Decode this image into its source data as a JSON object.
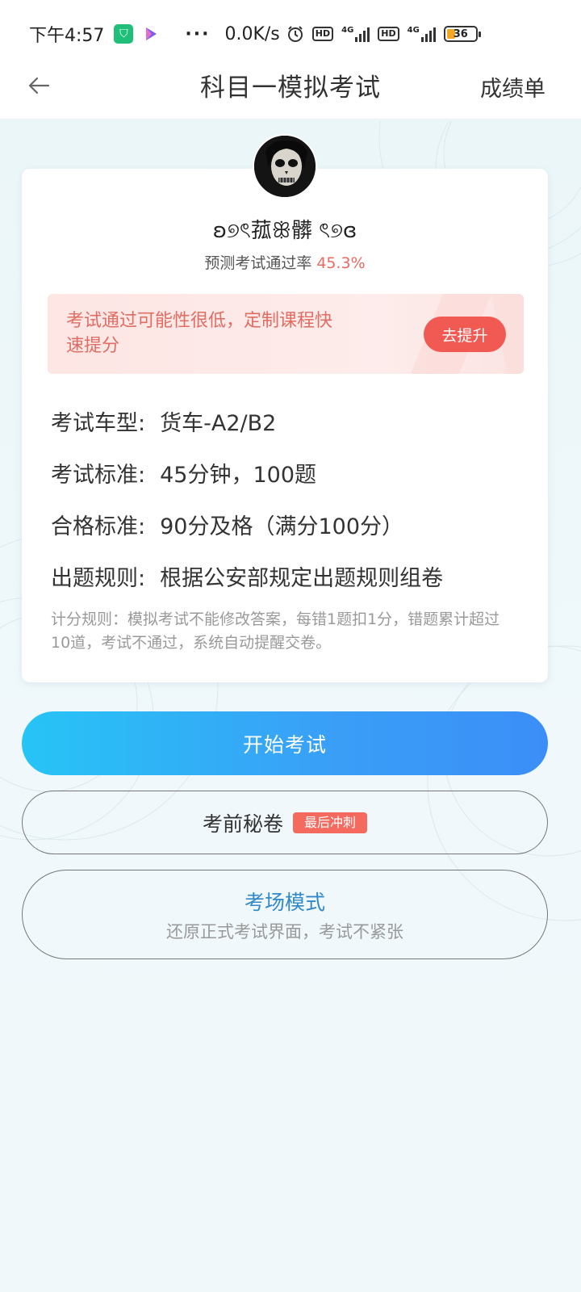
{
  "status_bar": {
    "time": "下午4:57",
    "net_speed": "0.0K/s",
    "hd_1": "HD",
    "hd_2": "HD",
    "net_1": "4G",
    "net_2": "4G",
    "battery": "36",
    "dots": "···"
  },
  "nav": {
    "title": "科目一模拟考试",
    "right_action": "成绩单"
  },
  "profile": {
    "username": "ʚ୭ৎ菰ꕥ髒 ৎ୭ɞ",
    "pass_rate_label": "预测考试通过率",
    "pass_rate_value": "45.3%"
  },
  "promo": {
    "text": "考试通过可能性很低，定制课程快速提分",
    "button": "去提升"
  },
  "info": {
    "car_type_label": "考试车型:",
    "car_type_value": "货车-A2/B2",
    "standard_label": "考试标准:",
    "standard_value": "45分钟，100题",
    "pass_label": "合格标准:",
    "pass_value": "90分及格（满分100分）",
    "rule_label": "出题规则:",
    "rule_value": "根据公安部规定出题规则组卷"
  },
  "note": "计分规则：模拟考试不能修改答案，每错1题扣1分，错题累计超过10道，考试不通过，系统自动提醒交卷。",
  "buttons": {
    "start": "开始考试",
    "secret": "考前秘卷",
    "secret_tag": "最后冲刺",
    "exam_mode_title": "考场模式",
    "exam_mode_sub": "还原正式考试界面，考试不紧张"
  },
  "colors": {
    "accent_blue": "#3b8ef7",
    "accent_cyan": "#27c4f6",
    "warn_red": "#f15a53",
    "pass_rate_red": "#e96a63",
    "mode_blue": "#3189c9"
  }
}
